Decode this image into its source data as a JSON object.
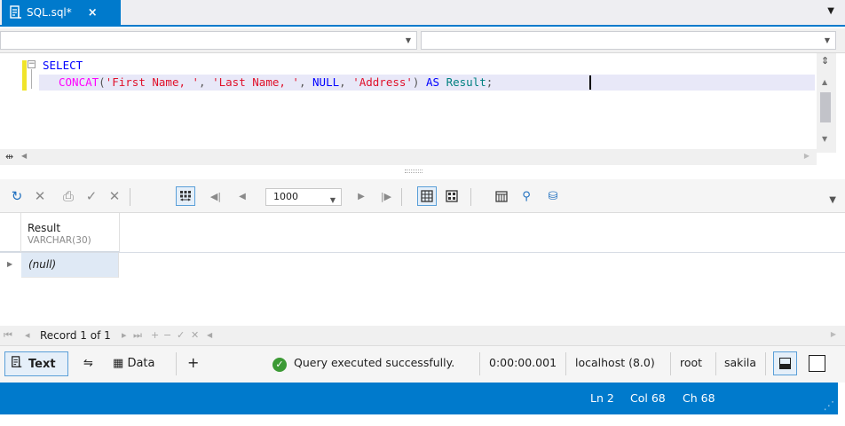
{
  "tab": {
    "title": "SQL.sql*",
    "close": "×"
  },
  "editor": {
    "line1": "SELECT",
    "line2": {
      "fn": "CONCAT",
      "open": "(",
      "s1": "'First Name, '",
      "c1": ", ",
      "s2": "'Last Name, '",
      "c2": ", ",
      "kw_null": "NULL",
      "c3": ", ",
      "s3": "'Address'",
      "close": ")",
      "kw_as": "AS",
      "alias": "Result",
      "semi": ";"
    }
  },
  "toolbar": {
    "limit_value": "1000"
  },
  "grid": {
    "columns": [
      {
        "name": "Result",
        "type": "VARCHAR(30)"
      }
    ],
    "rows": [
      {
        "value": "(null)"
      }
    ]
  },
  "navigator": {
    "first": "⏮",
    "prev": "◂",
    "record_text": "Record 1 of 1",
    "next": "▸",
    "last": "⏭",
    "add": "+",
    "remove": "−",
    "apply": "✓",
    "cancel": "✕"
  },
  "result_tabs": {
    "text_label": "Text",
    "data_label": "Data",
    "add": "+"
  },
  "status": {
    "message": "Query executed successfully.",
    "duration": "0:00:00.001",
    "server": "localhost (8.0)",
    "user": "root",
    "database": "sakila"
  },
  "statusbar": {
    "line": "Ln 2",
    "col": "Col 68",
    "ch": "Ch 68"
  },
  "colors": {
    "accent": "#007acc",
    "success": "#3c9a35",
    "keyword": "#0000ff",
    "function": "#ff00ff",
    "string": "#e0112b"
  }
}
